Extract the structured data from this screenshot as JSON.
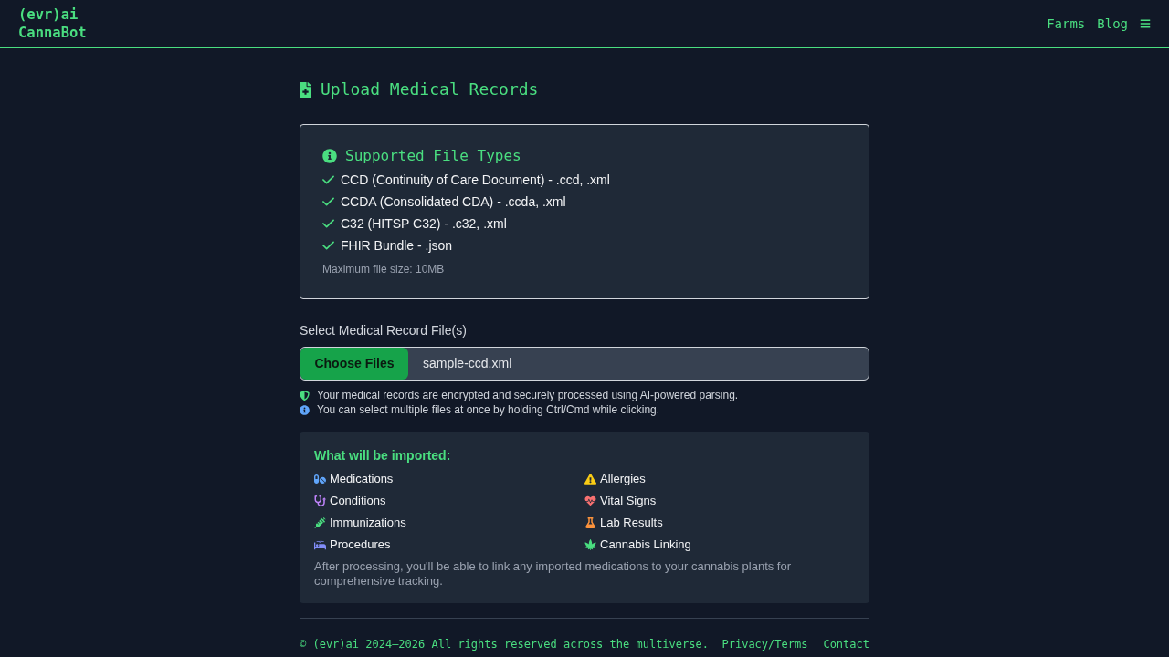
{
  "header": {
    "logo": [
      "(evr)ai",
      "CannaBot"
    ],
    "nav": [
      "Farms",
      "Blog"
    ]
  },
  "page_title": "Upload Medical Records",
  "supported_types": {
    "title": "Supported File Types",
    "items": [
      "CCD (Continuity of Care Document) - .ccd, .xml",
      "CCDA (Consolidated CDA) - .ccda, .xml",
      "C32 (HITSP C32) - .c32, .xml",
      "FHIR Bundle - .json"
    ],
    "note": "Maximum file size: 10MB"
  },
  "file_select": {
    "label": "Select Medical Record File(s)",
    "button": "Choose Files",
    "value": "sample-ccd.xml",
    "hints": [
      {
        "kind": "security",
        "text": "Your medical records are encrypted and securely processed using AI-powered parsing."
      },
      {
        "kind": "info",
        "text": "You can select multiple files at once by holding Ctrl/Cmd while clicking."
      }
    ]
  },
  "import_info": {
    "title": "What will be imported:",
    "items": [
      {
        "label": "Medications",
        "color": "#60a5fa"
      },
      {
        "label": "Allergies",
        "color": "#facc15"
      },
      {
        "label": "Conditions",
        "color": "#c084fc"
      },
      {
        "label": "Vital Signs",
        "color": "#f87171"
      },
      {
        "label": "Immunizations",
        "color": "#4ade80"
      },
      {
        "label": "Lab Results",
        "color": "#fb923c"
      },
      {
        "label": "Procedures",
        "color": "#818cf8"
      },
      {
        "label": "Cannabis Linking",
        "color": "#4ade80"
      }
    ],
    "note": "After processing, you'll be able to link any imported medications to your cannabis plants for comprehensive tracking."
  },
  "footer": {
    "copyright": "© (evr)ai 2024–2026 All rights reserved across the multiverse.",
    "links": [
      "Privacy/Terms",
      "Contact"
    ]
  }
}
